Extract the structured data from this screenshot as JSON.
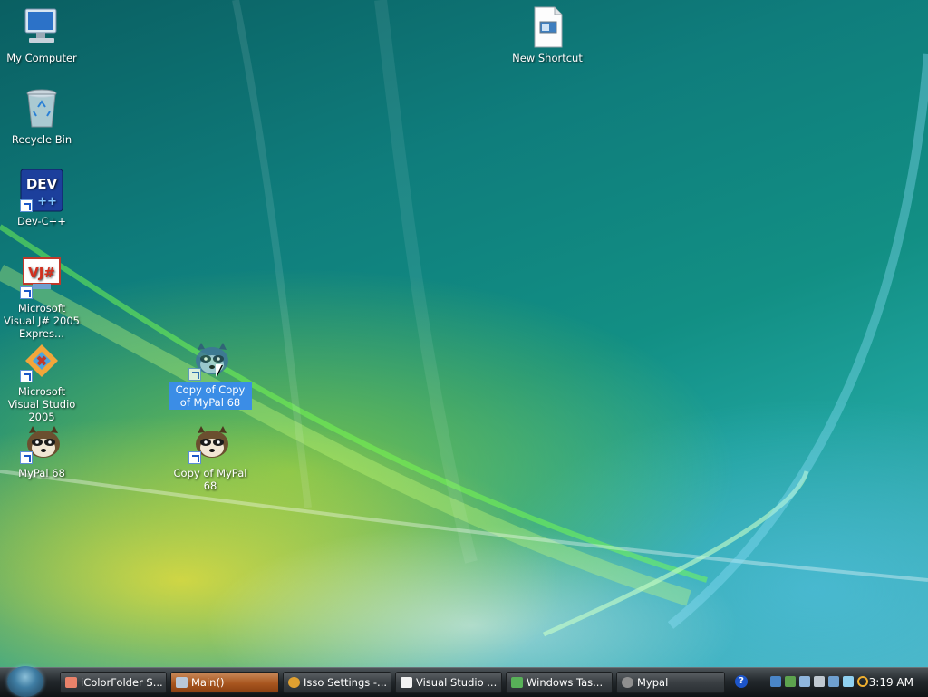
{
  "desktop": {
    "icons": [
      {
        "label": "My Computer",
        "icon": "computer-icon"
      },
      {
        "label": "Recycle Bin",
        "icon": "recycle-bin-icon"
      },
      {
        "label": "Dev-C++",
        "icon": "devcpp-icon"
      },
      {
        "label": "Microsoft Visual J# 2005 Expres...",
        "icon": "visual-jsharp-icon"
      },
      {
        "label": "Microsoft Visual Studio 2005",
        "icon": "visual-studio-icon"
      },
      {
        "label": "MyPal 68",
        "icon": "raccoon-icon"
      },
      {
        "label": "Copy of Copy of MyPal 68",
        "icon": "raccoon-icon",
        "selected": true
      },
      {
        "label": "Copy of MyPal 68",
        "icon": "raccoon-icon"
      },
      {
        "label": "New Shortcut",
        "icon": "shortcut-file-icon"
      }
    ]
  },
  "taskbar": {
    "items": [
      {
        "label": "iColorFolder S...",
        "icon": "folder-icon",
        "color": "#e9826a"
      },
      {
        "label": "Main()",
        "icon": "document-icon",
        "color": "#b9c7d8",
        "active": true
      },
      {
        "label": "Isso Settings -...",
        "icon": "firefox-icon",
        "color": "#e0a030"
      },
      {
        "label": "Visual Studio ...",
        "icon": "window-icon",
        "color": "#f2f2f2"
      },
      {
        "label": "Windows Tas...",
        "icon": "task-manager-icon",
        "color": "#58b158"
      },
      {
        "label": "Mypal",
        "icon": "raccoon-icon",
        "color": "#8f8f8f"
      }
    ],
    "clock": "3:19 AM",
    "help_symbol": "?"
  },
  "colors": {
    "selection": "#3b8de6",
    "taskbar_dark": "#23282c",
    "active_task": "#a8561f"
  }
}
